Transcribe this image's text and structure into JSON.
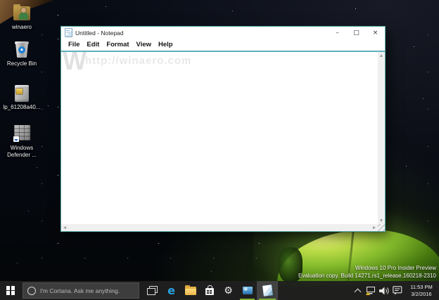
{
  "colors": {
    "taskbar_bg": "#1f1f1f",
    "accent_running_underline": "#7fae35",
    "window_border": "#55a39f",
    "edge_blue": "#2aa1e0",
    "explorer_yellow": "#e8b64c",
    "tent_green": "#84bb2c"
  },
  "desktop": {
    "icons": [
      {
        "label": "winaero"
      },
      {
        "label": "Recycle Bin"
      },
      {
        "label": "lp_61208a40..."
      },
      {
        "label": "Windows\nDefender ..."
      }
    ],
    "eval_watermark": {
      "line1": "Windows 10 Pro Insider Preview",
      "line2": "Evaluation copy. Build 14271.rs1_release.160218-2310"
    }
  },
  "notepad": {
    "title": "Untitled - Notepad",
    "menus": [
      "File",
      "Edit",
      "Format",
      "View",
      "Help"
    ],
    "controls": {
      "minimize": "–",
      "maximize": "□",
      "close": "×"
    },
    "watermark_w": "W",
    "watermark_url": "http://winaero.com"
  },
  "taskbar": {
    "cortana_placeholder": "I'm Cortana. Ask me anything.",
    "clock": {
      "time": "11:53 PM",
      "date": "3/2/2016"
    }
  }
}
